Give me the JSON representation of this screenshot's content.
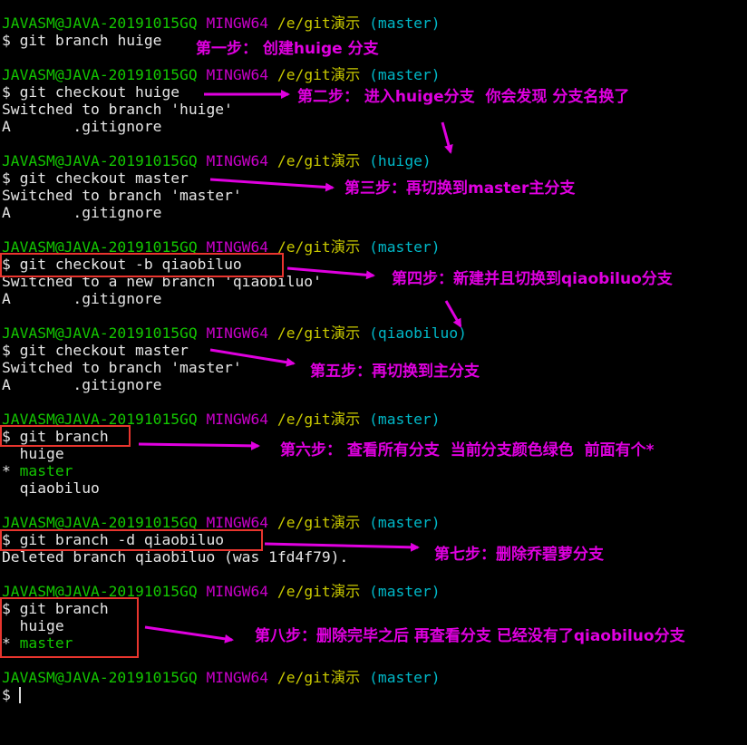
{
  "prompt": {
    "user": "JAVASM@JAVA-20191015GQ",
    "mingw": "MINGW64",
    "path": "/e/git演示",
    "master": "(master)",
    "huige": "(huige)",
    "qiaobiluo": "(qiaobiluo)",
    "dollar": "$"
  },
  "commands": {
    "c1": " git branch huige",
    "c2": " git checkout huige",
    "c3": " git checkout master",
    "c4": " git checkout -b qiaobiluo",
    "c5": " git checkout master",
    "c6": " git branch",
    "c7": " git branch -d qiaobiluo",
    "c8": " git branch"
  },
  "output": {
    "o2a": "Switched to branch 'huige'",
    "o2b": "A       .gitignore",
    "o3a": "Switched to branch 'master'",
    "o3b": "A       .gitignore",
    "o4a": "Switched to a new branch 'qiaobiluo'",
    "o4b": "A       .gitignore",
    "o5a": "Switched to branch 'master'",
    "o5b": "A       .gitignore",
    "o6a": "  huige",
    "o6b_star": "* ",
    "o6b_name": "master",
    "o6c": "  qiaobiluo",
    "o7a": "Deleted branch qiaobiluo (was 1fd4f79).",
    "o8a": "  huige",
    "o8b_star": "* ",
    "o8b_name": "master"
  },
  "annotations": {
    "a1": "第一步： 创建huige 分支",
    "a2": "第二步： 进入huige分支  你会发现 分支名换了",
    "a3": "第三步：再切换到master主分支",
    "a4": "第四步：新建并且切换到qiaobiluo分支",
    "a5": "第五步：再切换到主分支",
    "a6": "第六步： 查看所有分支  当前分支颜色绿色  前面有个*",
    "a7": "第七步：删除乔碧萝分支",
    "a8": "第八步：删除完毕之后 再查看分支 已经没有了qiaobiluo分支"
  },
  "colors": {
    "background": "#000000",
    "user": "#13c700",
    "mingw": "#c800c8",
    "path": "#c8c800",
    "branch": "#00b8c8",
    "annotation": "#e000e0",
    "box": "#e8352e"
  }
}
